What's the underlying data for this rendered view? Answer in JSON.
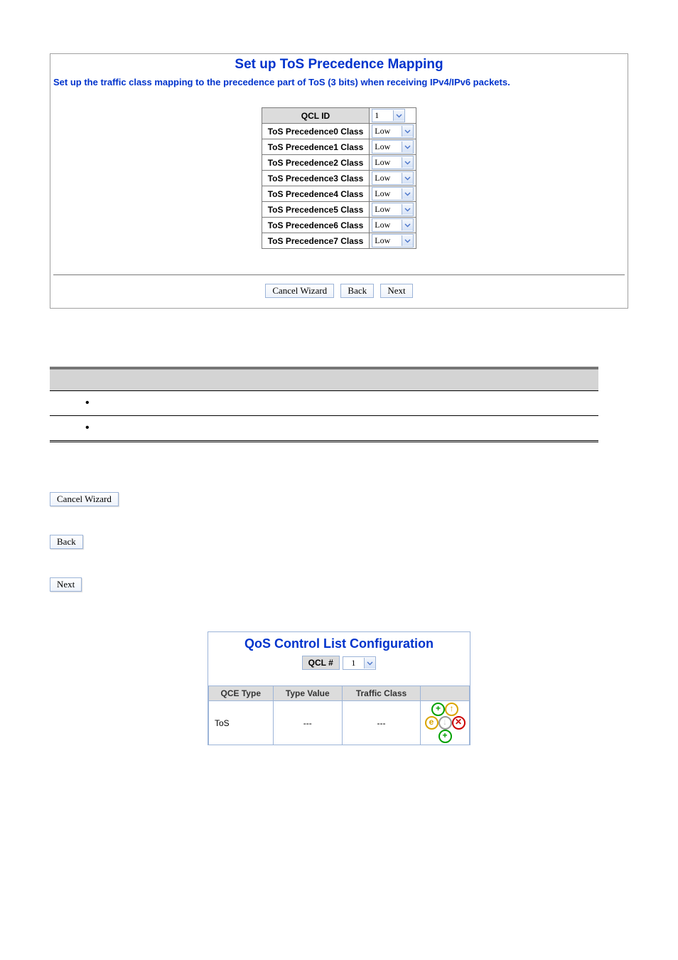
{
  "wizard": {
    "title": "Set up ToS Precedence Mapping",
    "subtitle": "Set up the traffic class mapping to the precedence part of ToS (3 bits) when receiving IPv4/IPv6 packets.",
    "qcl_label": "QCL ID",
    "qcl_value": "1",
    "rows": [
      {
        "label": "ToS Precedence0 Class",
        "value": "Low"
      },
      {
        "label": "ToS Precedence1 Class",
        "value": "Low"
      },
      {
        "label": "ToS Precedence2 Class",
        "value": "Low"
      },
      {
        "label": "ToS Precedence3 Class",
        "value": "Low"
      },
      {
        "label": "ToS Precedence4 Class",
        "value": "Low"
      },
      {
        "label": "ToS Precedence5 Class",
        "value": "Low"
      },
      {
        "label": "ToS Precedence6 Class",
        "value": "Low"
      },
      {
        "label": "ToS Precedence7 Class",
        "value": "Low"
      }
    ],
    "btn_cancel": "Cancel Wizard",
    "btn_back": "Back",
    "btn_next": "Next"
  },
  "standalone": {
    "cancel": "Cancel Wizard",
    "back": "Back",
    "next": "Next"
  },
  "qos": {
    "title": "QoS Control List Configuration",
    "qcl_label": "QCL #",
    "qcl_value": "1",
    "cols": {
      "c1": "QCE Type",
      "c2": "Type Value",
      "c3": "Traffic Class"
    },
    "row": {
      "type": "ToS",
      "value": "---",
      "cls": "---"
    }
  }
}
